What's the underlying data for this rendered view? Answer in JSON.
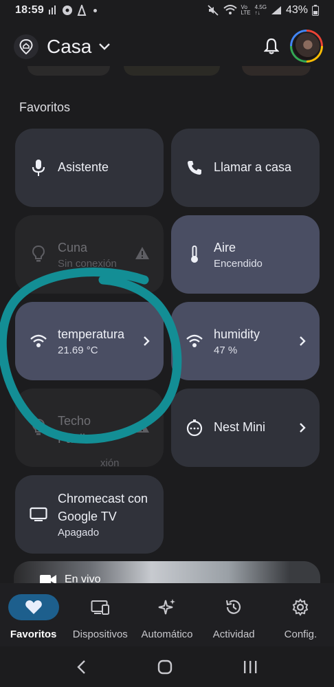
{
  "status": {
    "time": "18:59",
    "battery": "43%"
  },
  "header": {
    "title": "Casa"
  },
  "favorites_title": "Favoritos",
  "tiles": [
    {
      "name": "Asistente",
      "sub": ""
    },
    {
      "name": "Llamar a casa",
      "sub": ""
    },
    {
      "name": "Cuna",
      "sub": "Sin conexión"
    },
    {
      "name": "Aire",
      "sub": "Encendido"
    },
    {
      "name": "temperatura",
      "sub": "21.69 °C"
    },
    {
      "name": "humidity",
      "sub": "47 %"
    },
    {
      "name": "Techo Paulina",
      "sub": "xión"
    },
    {
      "name": "Nest Mini",
      "sub": ""
    },
    {
      "name": "Chromecast con Google TV",
      "sub": "Apagado"
    }
  ],
  "live": {
    "label": "En vivo"
  },
  "nav": [
    {
      "label": "Favoritos",
      "icon": "heart-icon"
    },
    {
      "label": "Dispositivos",
      "icon": "devices-icon"
    },
    {
      "label": "Automático",
      "icon": "sparkle-icon"
    },
    {
      "label": "Actividad",
      "icon": "history-icon"
    },
    {
      "label": "Config.",
      "icon": "gear-icon"
    }
  ],
  "colors": {
    "accent": "#1d5f8d",
    "tile_blue": "#4a4e63",
    "tile_dark": "#30323a",
    "scribble": "#138e95"
  }
}
